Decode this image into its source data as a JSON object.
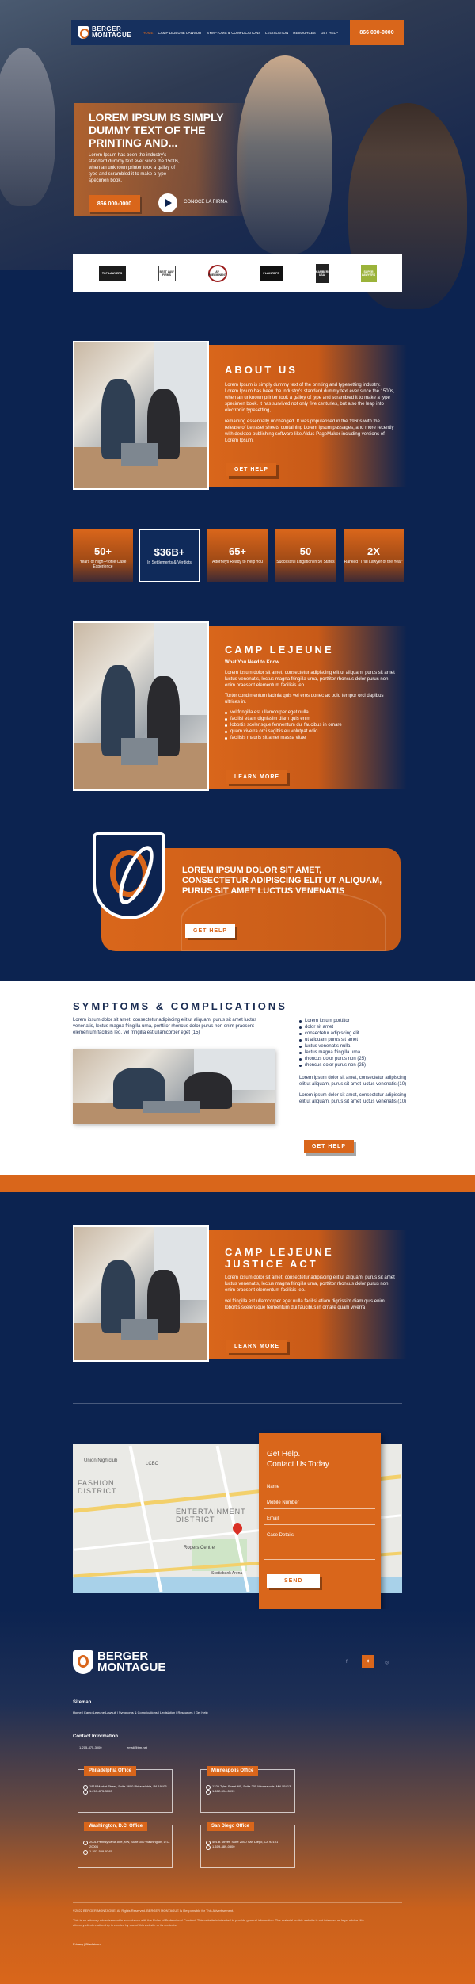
{
  "brand": {
    "name_line1": "BERGER",
    "name_line2": "MONTAGUE",
    "accent": "#d9661b",
    "navy": "#0c2350"
  },
  "nav": {
    "items": [
      "HOME",
      "CAMP LEJEUNE LAWSUIT",
      "SYMPTOMS & COMPLICATIONS",
      "LEGISLATION",
      "RESOURCES",
      "GET HELP"
    ],
    "phone": "866 000-0000"
  },
  "hero": {
    "title": "LOREM IPSUM IS SIMPLY DUMMY TEXT OF THE PRINTING AND...",
    "text": "Lorem Ipsum has been the industry's standard dummy text ever since the 1500s, when an unknown printer took a galley of type and scrambled it to make a type specimen book.",
    "phone": "866 000-0000",
    "video_label": "CONOCE LA FIRMA"
  },
  "awards": [
    "TOP LAWYERS",
    "BEST LAW FIRMS",
    "AV PREEMINENT",
    "PLAINTIFFS",
    "CHAMBERS USA",
    "SUPER LAWYERS"
  ],
  "about": {
    "title": "ABOUT US",
    "p1": "Lorem Ipsum is simply dummy text of the printing and typesetting industry. Lorem Ipsum has been the industry's standard dummy text ever since the 1500s, when an unknown printer took a galley of type and scrambled it to make a type specimen book. It has survived not only five centuries, but also the leap into electronic typesetting,",
    "p2": "remaining essentially unchanged. It was popularised in the 1960s with the release of Letraset sheets containing Lorem Ipsum passages, and more recently with desktop publishing software like Aldus PageMaker including versions of Lorem Ipsum.",
    "button": "GET HELP"
  },
  "stats": [
    {
      "value": "50+",
      "label": "Years of High-Profile Case Experience"
    },
    {
      "value": "$36B+",
      "label": "In Settlements & Verdicts"
    },
    {
      "value": "65+",
      "label": "Attorneys Ready to Help You"
    },
    {
      "value": "50",
      "label": "Successful Litigation in 50 States"
    },
    {
      "value": "2X",
      "label": "Ranked \"Trial Lawyer of the Year\""
    }
  ],
  "lejeune": {
    "title": "CAMP LEJEUNE",
    "subtitle": "What You Need to Know",
    "p1": "Lorem ipsum dolor sit amet, consectetur adipiscing elit ut aliquam, purus sit amet luctus venenatis, lectus magna fringilla urna, porttitor rhoncus dolor purus non enim praesent elementum facilisis leo.",
    "p2": "Tortor condimentum lacinia quis vel eros donec ac odio tempor orci dapibus ultrices in.",
    "bullets": [
      "vel fringilla est ullamcorper eget nulla",
      "facilisi etiam dignissim diam quis enim",
      "lobortis scelerisque fermentum dui faucibus in ornare",
      "quam viverra orci sagittis eu volutpat odio",
      "facilisis mauris sit amet massa vitae"
    ],
    "button": "LEARN MORE"
  },
  "banner": {
    "title": "LOREM IPSUM DOLOR SIT AMET, CONSECTETUR ADIPISCING ELIT UT ALIQUAM, PURUS SIT AMET LUCTUS VENENATIS",
    "button": "GET HELP"
  },
  "symptoms": {
    "title": "SYMPTOMS & COMPLICATIONS",
    "intro": "Lorem ipsum dolor sit amet, consectetur adipiscing elit ut aliquam, purus sit amet luctus venenatis, lectus magna fringilla urna, porttitor rhoncus dolor purus non enim praesent elementum facilisis leo, vel fringilla est ullamcorper eget (15)",
    "list": [
      "Lorem ipsum porttitor",
      "dolor sit amet",
      "consectetur adipiscing elit",
      "ut aliquam purus sit amet",
      "luctus venenatis nulla",
      "lectus magna fringilla urna",
      "rhoncus dolor purus non (25)",
      "rhoncus dolor purus non (25)"
    ],
    "p2": "Lorem ipsum dolor sit amet, consectetur adipiscing elit ut aliquam, purus sit amet luctus venenatis (10)",
    "p3": "Lorem ipsum dolor sit amet, consectetur adipiscing elit ut aliquam, purus sit amet luctus venenatis (10)",
    "button": "GET HELP"
  },
  "act": {
    "title_line1": "CAMP LEJEUNE",
    "title_line2": "JUSTICE ACT",
    "p1": "Lorem ipsum dolor sit amet, consectetur adipiscing elit ut aliquam, purus sit amet luctus venenatis, lectus magna fringilla urna, porttitor rhoncus dolor purus non enim praesent elementum facilisis leo.",
    "p2": "vel fringilla est ullamcorper eget nulla facilisi etiam dignissim diam quis enim lobortis scelerisque fermentum dui faucibus in ornare quam viverra",
    "button": "LEARN MORE"
  },
  "map": {
    "labels": [
      "Union Nightclub",
      "LCBO",
      "FASHION DISTRICT",
      "ENTERTAINMENT DISTRICT",
      "Rogers Centre",
      "Scotiabank Arena"
    ]
  },
  "contact_form": {
    "title_line1": "Get Help.",
    "title_line2": "Contact Us Today",
    "fields": [
      "Name",
      "Mobile Number",
      "Email",
      "Case Details"
    ],
    "button": "SEND"
  },
  "footer": {
    "logo_line1": "BERGER",
    "logo_line2": "MONTAGUE",
    "sitemap_title": "Sitemap",
    "sitemap_links": "Home | Camp Lejeune Lawsuit | Symptoms & Complications | Legislation | Resources | Get Help",
    "contact_title": "Contact Information",
    "phone": "1-215-875-3000",
    "email": "email@bm.net",
    "offices": [
      {
        "name": "Philadelphia Office",
        "address": "1818 Market Street, Suite 3600 Philadelphia, PA 19103",
        "phone": "1-215-875-3000"
      },
      {
        "name": "Minneapolis Office",
        "address": "1229 Tyler Street NE, Suite 205 Minneapolis, MN 55413",
        "phone": "1-612-594-5999"
      },
      {
        "name": "Washington, D.C. Office",
        "address": "2001 Pennsylvania Ave, NW, Suite 300 Washington, D.C. 20006",
        "phone": "1-202-559-9745"
      },
      {
        "name": "San Diego Office",
        "address": "401 B Street, Suite 2000 San Diego, CA 92101",
        "phone": "1-619-489-0300"
      }
    ],
    "copyright": "©2022 BERGER MONTAGUE. All Rights Reserved. BERGER MONTAGUE Is Responsible for This Advertisement.",
    "disclaimer": "This is an attorney advertisement in accordance with the Rules of Professional Conduct. This website is intended to provide general information. The material on this website is not intended as legal advice. No attorney-client relationship is created by use of this website or its contents.",
    "privacy": "Privacy | Disclaimer"
  }
}
